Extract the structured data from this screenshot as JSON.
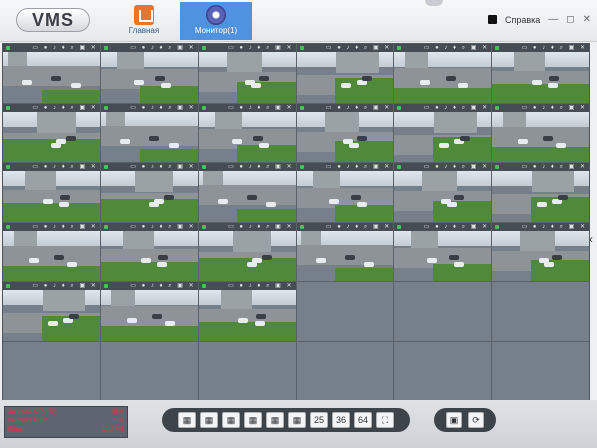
{
  "app": {
    "logo": "VMS"
  },
  "nav": [
    {
      "label": "Главная",
      "icon": "home-icon"
    },
    {
      "label": "Монитор(1)",
      "icon": "monitor-icon"
    }
  ],
  "top_right": {
    "help": "Справка",
    "icons": [
      "shirt-icon",
      "minimize-icon",
      "restore-icon",
      "close-icon"
    ]
  },
  "camera_toolbar_icons": [
    "monitor-icon",
    "record-icon",
    "audio-icon",
    "mic-icon",
    "zoom-icon",
    "snapshot-icon",
    "close-icon"
  ],
  "cells_active": 27,
  "stats": {
    "rows": [
      {
        "label": "Загрузка CPU(%):",
        "value": "86%"
      },
      {
        "label": "Загрузка ОЗУ:",
        "value": "75%"
      },
      {
        "label": "Бит/с:",
        "value": "10.2 МБ"
      }
    ]
  },
  "layout_buttons": [
    {
      "label": "",
      "icon": "layout-1-icon"
    },
    {
      "label": "",
      "icon": "layout-4-icon"
    },
    {
      "label": "",
      "icon": "layout-6-icon"
    },
    {
      "label": "",
      "icon": "layout-8-icon"
    },
    {
      "label": "",
      "icon": "layout-9-icon"
    },
    {
      "label": "",
      "icon": "layout-16-icon"
    },
    {
      "label": "25",
      "icon": ""
    },
    {
      "label": "36",
      "icon": ""
    },
    {
      "label": "64",
      "icon": ""
    },
    {
      "label": "",
      "icon": "fullscreen-icon"
    }
  ],
  "right_buttons": [
    {
      "label": "",
      "icon": "save-icon"
    },
    {
      "label": "",
      "icon": "refresh-icon"
    }
  ],
  "colors": {
    "accent": "#4f93e0",
    "home": "#e8752c",
    "stats_text": "#e13636"
  }
}
